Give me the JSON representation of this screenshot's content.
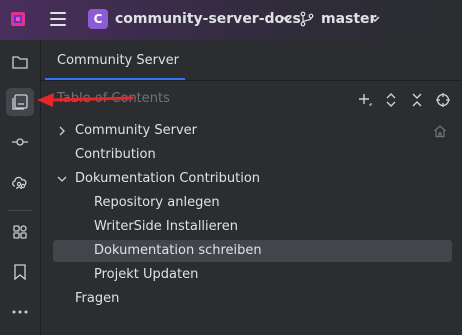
{
  "titlebar": {
    "project_badge": "C",
    "project_name": "community-server-docs",
    "branch_name": "master"
  },
  "toolstrip": {
    "items": [
      {
        "icon": "folder-icon"
      },
      {
        "icon": "document-structure-icon",
        "active": true
      },
      {
        "icon": "commit-icon"
      },
      {
        "icon": "cloud-users-icon"
      },
      {
        "icon": "grid-apps-icon"
      },
      {
        "icon": "bookmark-icon"
      },
      {
        "icon": "more-dots-icon"
      }
    ]
  },
  "panel": {
    "tab_label": "Community Server",
    "toc_title": "Table of Contents",
    "header_icons": [
      "add-icon",
      "expand-icon",
      "collapse-icon",
      "locate-icon"
    ]
  },
  "tree": [
    {
      "label": "Community Server",
      "level": 0,
      "chevron": "right",
      "home": true
    },
    {
      "label": "Contribution",
      "level": 0,
      "chevron": null
    },
    {
      "label": "Dokumentation Contribution",
      "level": 0,
      "chevron": "down"
    },
    {
      "label": "Repository anlegen",
      "level": 1,
      "chevron": null
    },
    {
      "label": "WriterSide Installieren",
      "level": 1,
      "chevron": null
    },
    {
      "label": "Dokumentation schreiben",
      "level": 1,
      "chevron": null,
      "selected": true
    },
    {
      "label": "Projekt Updaten",
      "level": 1,
      "chevron": null
    },
    {
      "label": "Fragen",
      "level": 0,
      "chevron": null
    }
  ],
  "colors": {
    "accent": "#3574f0",
    "annotation_arrow": "#e8262a",
    "project_badge": "#8e5cd6"
  }
}
